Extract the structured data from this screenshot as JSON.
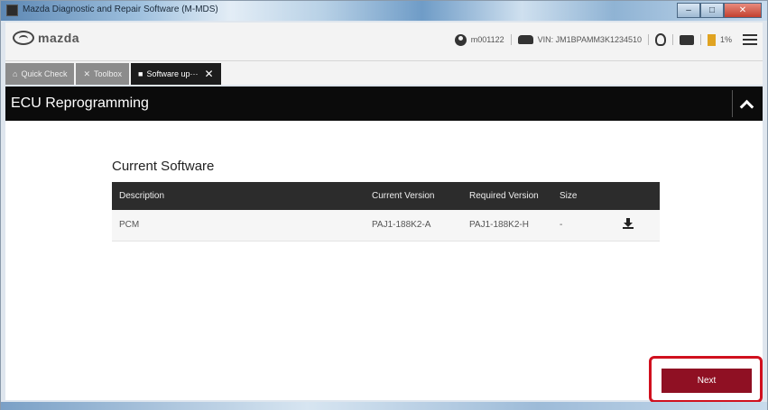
{
  "window": {
    "title": "Mazda Diagnostic and Repair Software (M-MDS)",
    "buttons": {
      "minimize": "–",
      "maximize": "□",
      "close": "✕"
    }
  },
  "header": {
    "brand": "mazda",
    "user": "m001122",
    "vin": "VIN: JM1BPAMM3K1234510"
  },
  "tabs": [
    {
      "label": "Quick Check",
      "icon": "home-icon",
      "active": false
    },
    {
      "label": "Toolbox",
      "icon": "tools-icon",
      "active": false
    },
    {
      "label": "Software up···",
      "icon": "chip-icon",
      "active": true,
      "close": "✕"
    }
  ],
  "section": {
    "title": "ECU Reprogramming"
  },
  "software": {
    "title": "Current Software",
    "columns": [
      "Description",
      "Current Version",
      "Required Version",
      "Size",
      ""
    ],
    "rows": [
      {
        "description": "PCM",
        "current": "PAJ1-188K2-A",
        "required": "PAJ1-188K2-H",
        "size": "-"
      }
    ]
  },
  "footer": {
    "next_label": "Next"
  },
  "colors": {
    "accent": "#8f1023",
    "highlight": "#d0101e",
    "section_bg": "#0b0b0b"
  }
}
